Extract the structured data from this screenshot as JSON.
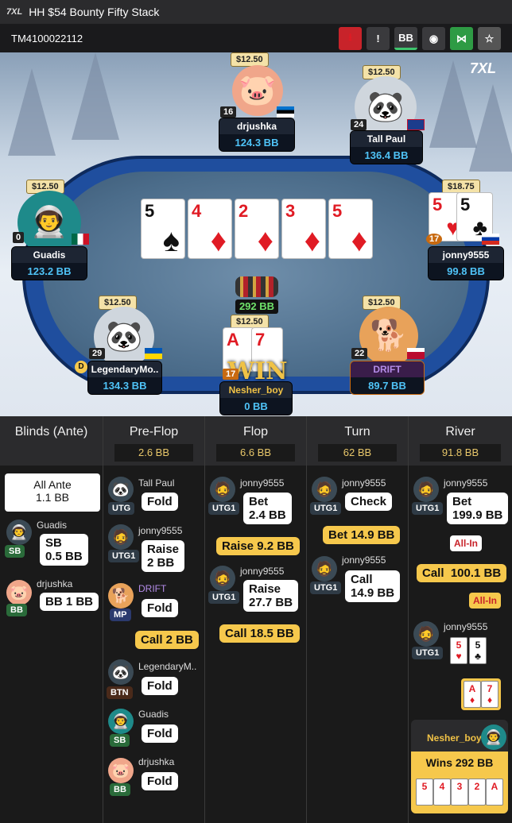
{
  "titlebar": {
    "logo": "7XL",
    "title": "HH  $54 Bounty Fifty Stack"
  },
  "subbar": {
    "hand_id": "TM4100022112"
  },
  "toolbar": {
    "download": "⭳",
    "report": "!",
    "bb": "BB",
    "incognito": "◉",
    "share": "⋈",
    "star": "☆"
  },
  "table": {
    "brand": "7XL",
    "board": [
      {
        "rank": "5",
        "suit": "♠",
        "color": "blk"
      },
      {
        "rank": "4",
        "suit": "♦",
        "color": "red"
      },
      {
        "rank": "2",
        "suit": "♦",
        "color": "red"
      },
      {
        "rank": "3",
        "suit": "♦",
        "color": "red"
      },
      {
        "rank": "5",
        "suit": "♦",
        "color": "red"
      }
    ],
    "pot": "292 BB",
    "players": [
      {
        "name": "drjushka",
        "stack": "124.3 BB",
        "bounty": "$12.50",
        "level": "16"
      },
      {
        "name": "Tall Paul",
        "stack": "136.4 BB",
        "bounty": "$12.50",
        "level": "24"
      },
      {
        "name": "Guadis",
        "stack": "123.2 BB",
        "bounty": "$12.50",
        "level": "0"
      },
      {
        "name": "jonny9555",
        "stack": "99.8 BB",
        "bounty": "$18.75",
        "level": "17"
      },
      {
        "name": "LegendaryMo..",
        "stack": "134.3 BB",
        "bounty": "$12.50",
        "level": "29"
      },
      {
        "name": "Nesher_boy",
        "stack": "0 BB",
        "bounty": "$12.50",
        "level": "17"
      },
      {
        "name": "DRIFT",
        "stack": "89.7 BB",
        "bounty": "$12.50",
        "level": "22"
      }
    ],
    "hero_cards": [
      {
        "rank": "A",
        "suit": "♦"
      },
      {
        "rank": "7",
        "suit": "♦"
      }
    ],
    "villain_cards": [
      {
        "rank": "5",
        "suit": "♥",
        "color": "red"
      },
      {
        "rank": "5",
        "suit": "♣",
        "color": "blk"
      }
    ],
    "win_label": "WIN",
    "dealer": "D"
  },
  "history": {
    "cols": [
      {
        "title": "Blinds (Ante)",
        "value": ""
      },
      {
        "title": "Pre-Flop",
        "value": "2.6 BB"
      },
      {
        "title": "Flop",
        "value": "6.6 BB"
      },
      {
        "title": "Turn",
        "value": "62 BB"
      },
      {
        "title": "River",
        "value": "91.8 BB"
      }
    ],
    "blinds": {
      "ante_label": "All Ante",
      "ante_value": "1.1 BB",
      "sb": {
        "name": "Guadis",
        "pos": "SB",
        "action": "SB\n0.5 BB"
      },
      "bb": {
        "name": "drjushka",
        "pos": "BB",
        "action": "BB 1 BB"
      }
    },
    "preflop": [
      {
        "name": "Tall Paul",
        "pos": "UTG",
        "action": "Fold"
      },
      {
        "name": "jonny9555",
        "pos": "UTG1",
        "action": "Raise\n2 BB"
      },
      {
        "name": "DRIFT",
        "pos": "MP",
        "action": "Fold"
      },
      {
        "hero": "Call 2 BB"
      },
      {
        "name": "LegendaryM..",
        "pos": "BTN",
        "action": "Fold"
      },
      {
        "name": "Guadis",
        "pos": "SB",
        "action": "Fold"
      },
      {
        "name": "drjushka",
        "pos": "BB",
        "action": "Fold"
      }
    ],
    "flop": [
      {
        "name": "jonny9555",
        "pos": "UTG1",
        "action": "Bet\n2.4 BB"
      },
      {
        "hero": "Raise 9.2 BB"
      },
      {
        "name": "jonny9555",
        "pos": "UTG1",
        "action": "Raise\n27.7 BB"
      },
      {
        "hero": "Call 18.5 BB"
      }
    ],
    "turn": [
      {
        "name": "jonny9555",
        "pos": "UTG1",
        "action": "Check"
      },
      {
        "hero": "Bet 14.9 BB"
      },
      {
        "name": "jonny9555",
        "pos": "UTG1",
        "action": "Call\n14.9 BB"
      }
    ],
    "river": {
      "a1": {
        "name": "jonny9555",
        "pos": "UTG1",
        "action": "Bet\n199.9 BB",
        "allin": "All-In"
      },
      "hero": "Call  100.1 BB",
      "hero_allin": "All-In",
      "show": {
        "name": "jonny9555",
        "pos": "UTG1"
      },
      "winner": {
        "name": "Nesher_boy",
        "text": "Wins 292 BB"
      },
      "win_cards": [
        "5",
        "4",
        "3",
        "2",
        "A"
      ]
    }
  }
}
